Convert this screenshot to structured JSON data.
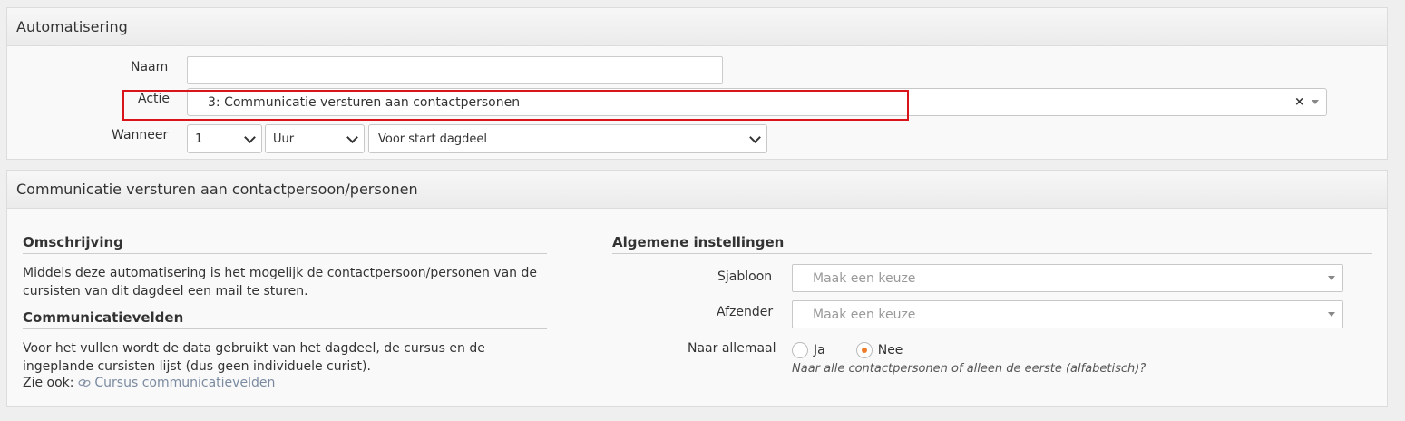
{
  "automation": {
    "title": "Automatisering",
    "naam_label": "Naam",
    "naam_value": "",
    "actie_label": "Actie",
    "actie_value": "3: Communicatie versturen aan contactpersonen",
    "clear_symbol": "×",
    "wanneer_label": "Wanneer",
    "wanneer_amount": "1",
    "wanneer_unit": "Uur",
    "wanneer_moment": "Voor start dagdeel"
  },
  "communication": {
    "title": "Communicatie versturen aan contactpersoon/personen",
    "omschrijving_title": "Omschrijving",
    "omschrijving_text": "Middels deze automatisering is het mogelijk de contactpersoon/personen van de cursisten van dit dagdeel een mail te sturen.",
    "velden_title": "Communicatievelden",
    "velden_text": "Voor het vullen wordt de data gebruikt van het dagdeel, de cursus en de ingeplande cursisten lijst (dus geen individuele curist).",
    "zie_ook": "Zie ook:",
    "zie_ook_link": "Cursus communicatievelden",
    "settings_title": "Algemene instellingen",
    "sjabloon_label": "Sjabloon",
    "sjabloon_placeholder": "Maak een keuze",
    "afzender_label": "Afzender",
    "afzender_placeholder": "Maak een keuze",
    "allemaal_label": "Naar allemaal",
    "option_ja": "Ja",
    "option_nee": "Nee",
    "selected": "Nee",
    "allemaal_hint": "Naar alle contactpersonen of alleen de eerste (alfabetisch)?"
  },
  "colors": {
    "highlight": "#d9141b",
    "radio_selected": "#f07c2a"
  },
  "icons": {
    "link": "link-icon",
    "dropdown": "chevron-down-icon",
    "clear": "close-icon"
  }
}
